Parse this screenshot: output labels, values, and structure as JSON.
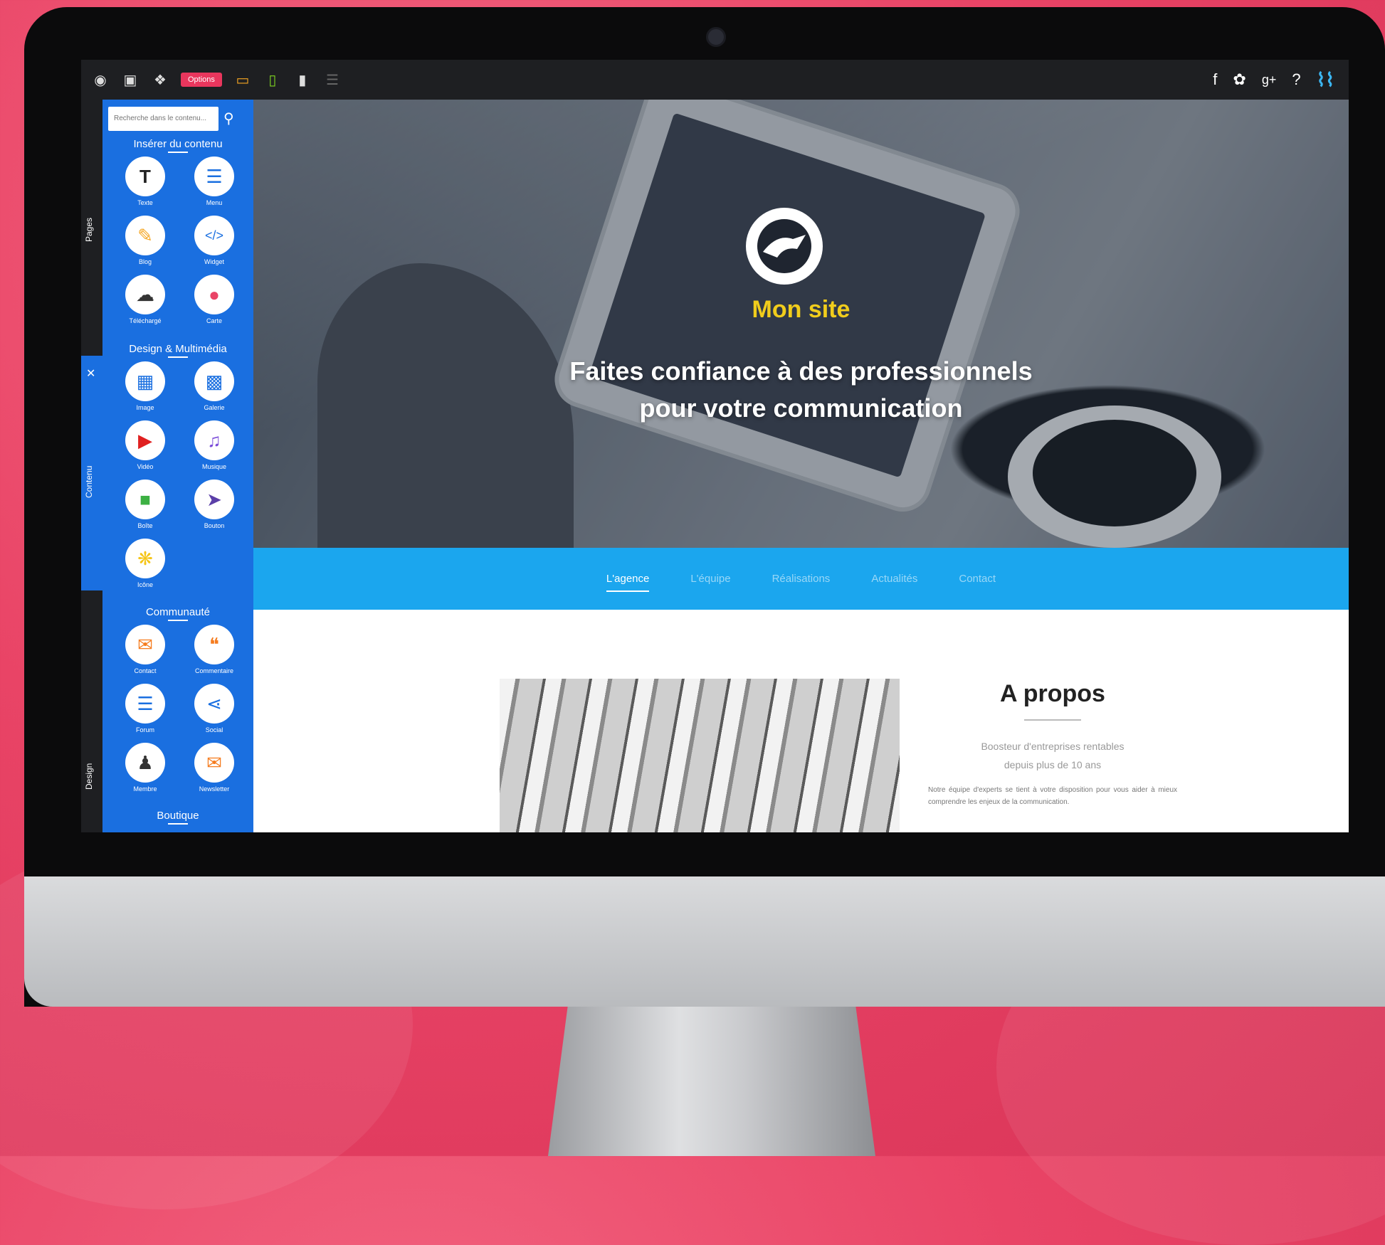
{
  "toolbar": {
    "pill_label": "Options",
    "right_icons": [
      "facebook-icon",
      "twitter-icon",
      "google-plus-icon",
      "help-icon",
      "brand-logo"
    ],
    "social": {
      "facebook": "f",
      "google_plus": "g+",
      "help": "?"
    }
  },
  "rail": {
    "tab_pages": "Pages",
    "tab_contenu": "Contenu",
    "tab_design": "Design"
  },
  "sidebar": {
    "search_placeholder": "Recherche dans le contenu...",
    "sections": {
      "inserer": "Insérer du contenu",
      "design": "Design & Multimédia",
      "communaute": "Communauté",
      "boutique": "Boutique"
    },
    "items": [
      {
        "label": "Texte",
        "icon": "text-icon"
      },
      {
        "label": "Menu",
        "icon": "list-icon"
      },
      {
        "label": "Blog",
        "icon": "pencil-icon"
      },
      {
        "label": "Widget",
        "icon": "code-icon"
      },
      {
        "label": "Téléchargé",
        "icon": "download-icon"
      },
      {
        "label": "Carte",
        "icon": "map-pin-icon"
      },
      {
        "label": "Image",
        "icon": "image-icon"
      },
      {
        "label": "Galerie",
        "icon": "gallery-icon"
      },
      {
        "label": "Vidéo",
        "icon": "play-icon"
      },
      {
        "label": "Musique",
        "icon": "music-icon"
      },
      {
        "label": "Boîte",
        "icon": "box-icon"
      },
      {
        "label": "Bouton",
        "icon": "cursor-icon"
      },
      {
        "label": "Icône",
        "icon": "lightbulb-icon"
      },
      {
        "label": "Contact",
        "icon": "envelope-icon"
      },
      {
        "label": "Commentaire",
        "icon": "comment-icon"
      },
      {
        "label": "Forum",
        "icon": "chat-icon"
      },
      {
        "label": "Social",
        "icon": "share-icon"
      },
      {
        "label": "Membre",
        "icon": "members-icon"
      },
      {
        "label": "Newsletter",
        "icon": "newsletter-icon"
      }
    ]
  },
  "hero": {
    "title": "Mon site",
    "subtitle_line1": "Faites confiance à des professionnels",
    "subtitle_line2": "pour votre communication"
  },
  "nav": {
    "items": [
      "L'agence",
      "L'équipe",
      "Réalisations",
      "Actualités",
      "Contact"
    ],
    "active": "L'agence"
  },
  "about": {
    "title": "A propos",
    "tagline_line1": "Boosteur d'entreprises rentables",
    "tagline_line2": "depuis plus de 10 ans",
    "body": "Notre équipe d'experts se tient à votre disposition pour vous aider à mieux comprendre les enjeux de la communication."
  },
  "colors": {
    "background": "#e94466",
    "toolbar": "#1e1f22",
    "sidebar": "#1a6fe0",
    "nav": "#1ba6ee",
    "hero_title": "#f1cd1c",
    "pill": "#e9365d"
  }
}
